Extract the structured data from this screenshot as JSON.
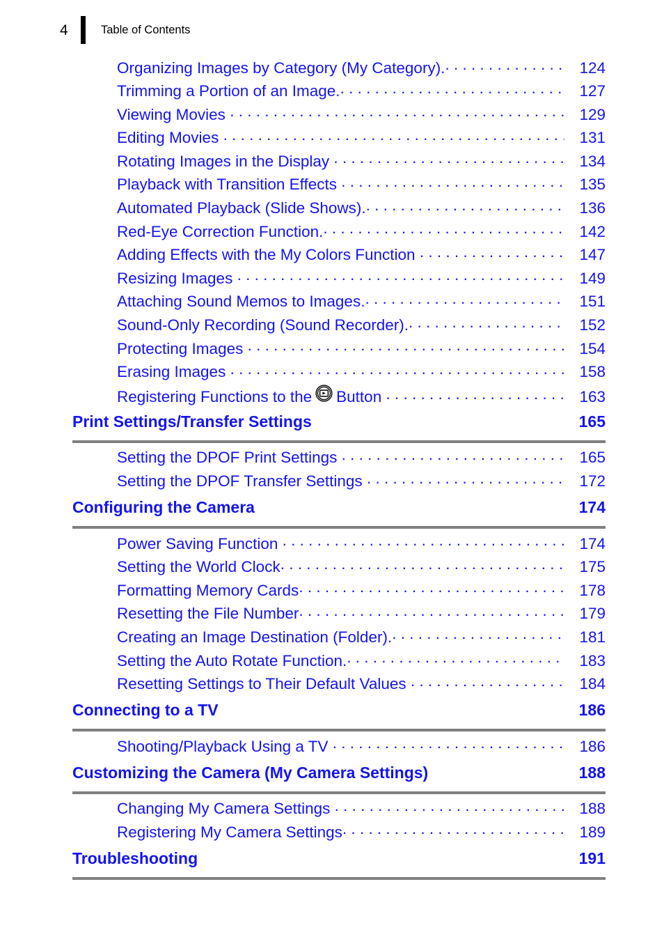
{
  "header": {
    "folio": "4",
    "title": "Table of Contents"
  },
  "colors": {
    "link_blue": "#1414f0",
    "rule_gray": "#808080",
    "header_black": "#000000"
  },
  "toc": {
    "leading_entries": [
      {
        "title": "Organizing Images by Category (My Category).",
        "page": "124",
        "gap": false
      },
      {
        "title": "Trimming a Portion of an Image.",
        "page": "127",
        "gap": false
      },
      {
        "title": "Viewing Movies",
        "page": "129",
        "gap": true
      },
      {
        "title": "Editing Movies",
        "page": "131",
        "gap": true
      },
      {
        "title": "Rotating Images in the Display",
        "page": "134",
        "gap": true
      },
      {
        "title": "Playback with Transition Effects",
        "page": "135",
        "gap": true
      },
      {
        "title": "Automated Playback (Slide Shows).",
        "page": "136",
        "gap": false
      },
      {
        "title": "Red-Eye Correction Function.",
        "page": "142",
        "gap": false
      },
      {
        "title": "Adding Effects with the My Colors Function",
        "page": "147",
        "gap": true
      },
      {
        "title": "Resizing Images",
        "page": "149",
        "gap": true
      },
      {
        "title": "Attaching Sound Memos to Images.",
        "page": "151",
        "gap": false
      },
      {
        "title": "Sound-Only Recording (Sound Recorder).",
        "page": "152",
        "gap": false
      },
      {
        "title": "Protecting Images",
        "page": "154",
        "gap": true
      },
      {
        "title": "Erasing Images",
        "page": "158",
        "gap": true
      }
    ],
    "icon_entry": {
      "title_before": "Registering Functions to the",
      "icon": "playback-button-icon",
      "title_after": "Button",
      "page": "163"
    },
    "sections": [
      {
        "title": "Print Settings/Transfer Settings",
        "page": "165",
        "entries": [
          {
            "title": "Setting the DPOF Print Settings",
            "page": "165",
            "gap": true
          },
          {
            "title": "Setting the DPOF Transfer Settings",
            "page": "172",
            "gap": true
          }
        ]
      },
      {
        "title": "Configuring the Camera",
        "page": "174",
        "entries": [
          {
            "title": "Power Saving Function",
            "page": "174",
            "gap": true
          },
          {
            "title": "Setting the World Clock",
            "page": "175",
            "gap": false
          },
          {
            "title": "Formatting Memory Cards",
            "page": "178",
            "gap": false
          },
          {
            "title": "Resetting the File Number",
            "page": "179",
            "gap": false
          },
          {
            "title": "Creating an Image Destination (Folder).",
            "page": "181",
            "gap": false
          },
          {
            "title": "Setting the Auto Rotate Function.",
            "page": "183",
            "gap": false
          },
          {
            "title": "Resetting Settings to Their Default Values",
            "page": "184",
            "gap": true
          }
        ]
      },
      {
        "title": "Connecting to a TV",
        "page": "186",
        "entries": [
          {
            "title": "Shooting/Playback Using a TV",
            "page": "186",
            "gap": true
          }
        ]
      },
      {
        "title": "Customizing the Camera (My Camera Settings)",
        "page": "188",
        "entries": [
          {
            "title": "Changing My Camera Settings",
            "page": "188",
            "gap": true
          },
          {
            "title": "Registering My Camera Settings",
            "page": "189",
            "gap": false
          }
        ]
      },
      {
        "title": "Troubleshooting",
        "page": "191",
        "entries": []
      }
    ]
  }
}
